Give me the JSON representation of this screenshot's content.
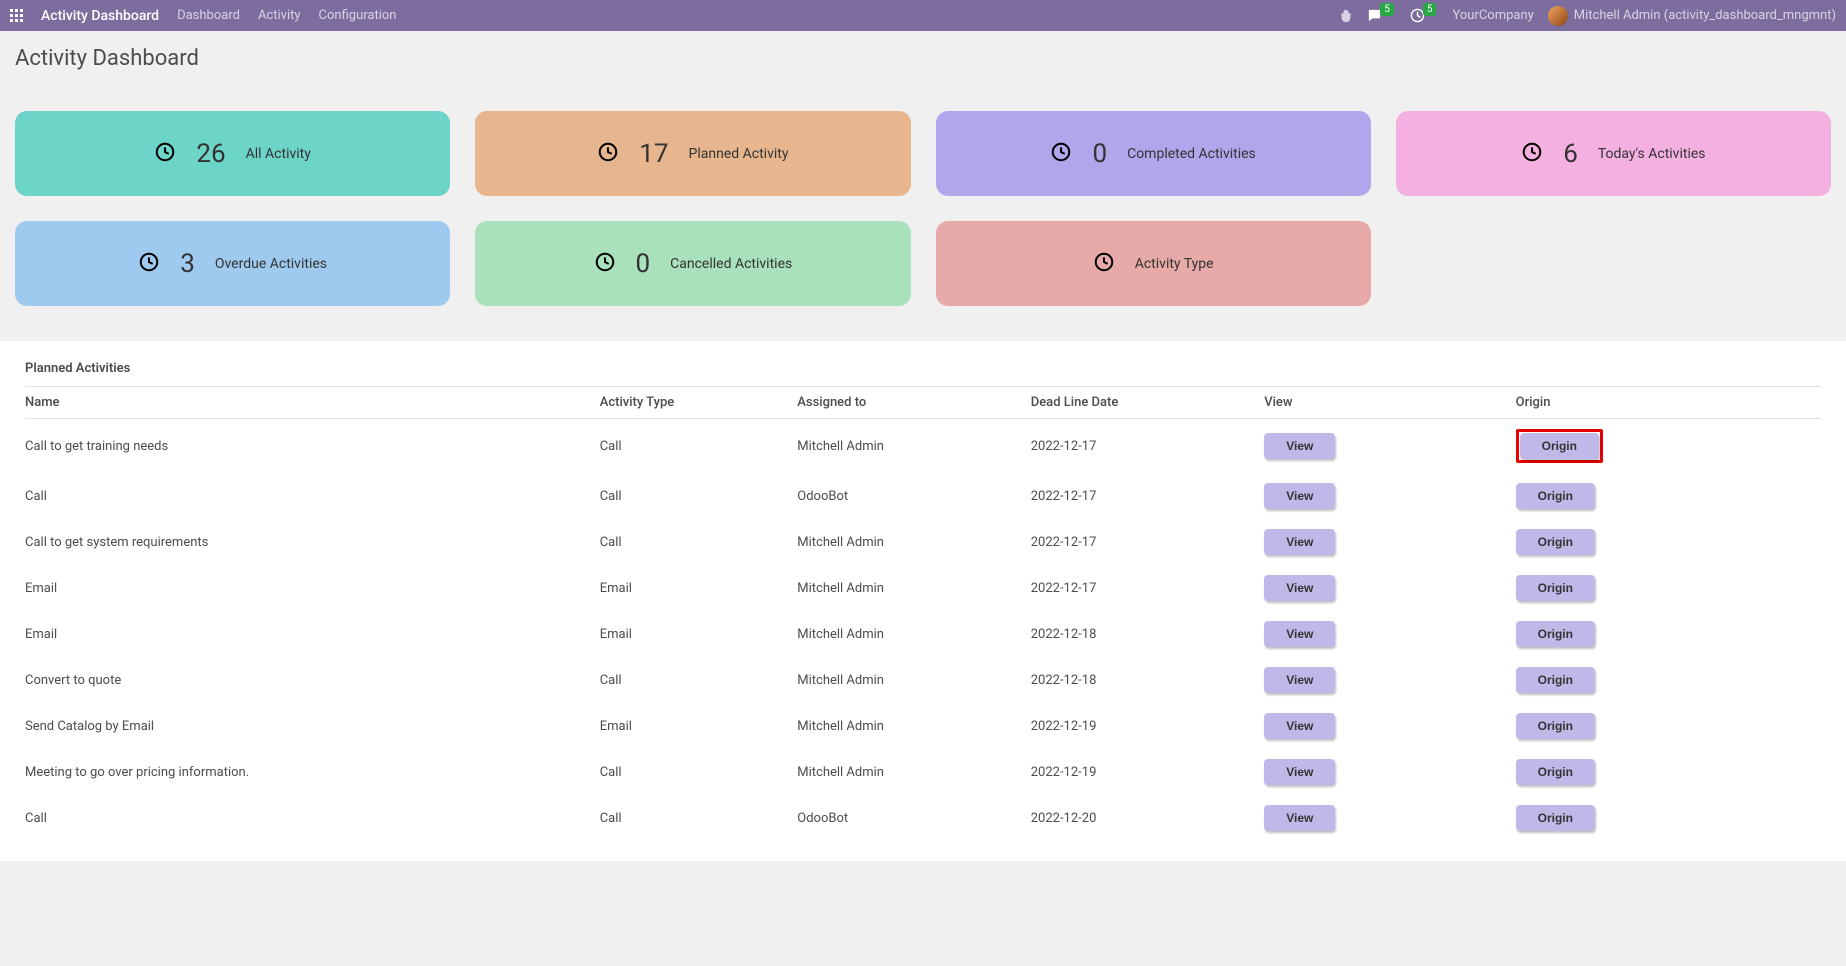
{
  "navbar": {
    "title": "Activity Dashboard",
    "links": [
      "Dashboard",
      "Activity",
      "Configuration"
    ],
    "messages_badge": "5",
    "activities_badge": "5",
    "company": "YourCompany",
    "user": "Mitchell Admin (activity_dashboard_mngmnt)"
  },
  "page": {
    "title": "Activity Dashboard"
  },
  "cards": [
    {
      "count": "26",
      "label": "All Activity",
      "class": "card-teal"
    },
    {
      "count": "17",
      "label": "Planned Activity",
      "class": "card-orange"
    },
    {
      "count": "0",
      "label": "Completed Activities",
      "class": "card-purple"
    },
    {
      "count": "6",
      "label": "Today's Activities",
      "class": "card-pink"
    },
    {
      "count": "3",
      "label": "Overdue Activities",
      "class": "card-blue"
    },
    {
      "count": "0",
      "label": "Cancelled Activities",
      "class": "card-green"
    },
    {
      "count": "",
      "label": "Activity Type",
      "class": "card-red"
    }
  ],
  "table": {
    "title": "Planned Activities",
    "headers": {
      "name": "Name",
      "type": "Activity Type",
      "assigned": "Assigned to",
      "date": "Dead Line Date",
      "view": "View",
      "origin": "Origin"
    },
    "view_button": "View",
    "origin_button": "Origin",
    "rows": [
      {
        "name": "Call to get training needs",
        "type": "Call",
        "assigned": "Mitchell Admin",
        "date": "2022-12-17",
        "highlight_origin": true
      },
      {
        "name": "Call",
        "type": "Call",
        "assigned": "OdooBot",
        "date": "2022-12-17"
      },
      {
        "name": "Call to get system requirements",
        "type": "Call",
        "assigned": "Mitchell Admin",
        "date": "2022-12-17"
      },
      {
        "name": "Email",
        "type": "Email",
        "assigned": "Mitchell Admin",
        "date": "2022-12-17"
      },
      {
        "name": "Email",
        "type": "Email",
        "assigned": "Mitchell Admin",
        "date": "2022-12-18"
      },
      {
        "name": "Convert to quote",
        "type": "Call",
        "assigned": "Mitchell Admin",
        "date": "2022-12-18"
      },
      {
        "name": "Send Catalog by Email",
        "type": "Email",
        "assigned": "Mitchell Admin",
        "date": "2022-12-19"
      },
      {
        "name": "Meeting to go over pricing information.",
        "type": "Call",
        "assigned": "Mitchell Admin",
        "date": "2022-12-19"
      },
      {
        "name": "Call",
        "type": "Call",
        "assigned": "OdooBot",
        "date": "2022-12-20"
      }
    ]
  }
}
